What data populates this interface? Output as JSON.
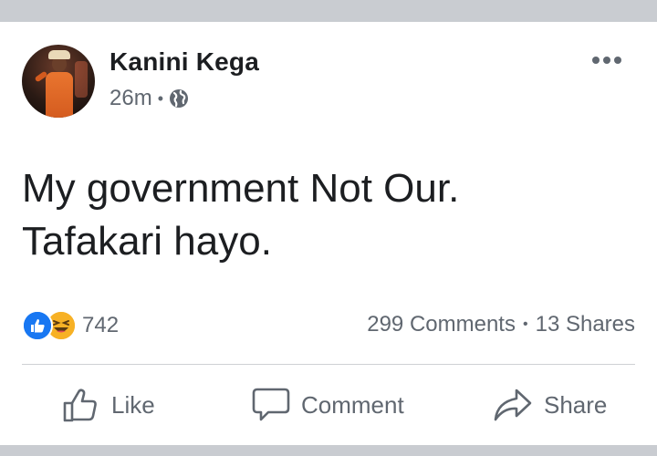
{
  "post": {
    "author": "Kanini Kega",
    "time": "26m",
    "privacy_icon": "globe-icon",
    "more_icon": "more-options-icon",
    "text_lines": [
      "My government Not Our.",
      "Tafakari hayo."
    ]
  },
  "reactions": {
    "icons": [
      "like-reaction-icon",
      "haha-reaction-icon"
    ],
    "count": "742"
  },
  "stats": {
    "comments": "299 Comments",
    "shares": "13 Shares"
  },
  "actions": {
    "like": "Like",
    "comment": "Comment",
    "share": "Share"
  },
  "colors": {
    "like_blue": "#1877f2",
    "haha_yellow": "#f7b125",
    "text_primary": "#1c1e21",
    "text_secondary": "#606770",
    "background": "#c9ccd1"
  }
}
